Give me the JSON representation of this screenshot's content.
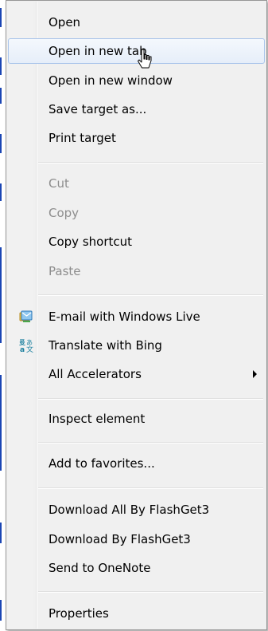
{
  "menu": {
    "items": [
      {
        "label": "Open",
        "state": "normal"
      },
      {
        "label": "Open in new tab",
        "state": "hover"
      },
      {
        "label": "Open in new window",
        "state": "normal"
      },
      {
        "label": "Save target as...",
        "state": "normal"
      },
      {
        "label": "Print target",
        "state": "normal"
      },
      {
        "label": "Cut",
        "state": "disabled"
      },
      {
        "label": "Copy",
        "state": "disabled"
      },
      {
        "label": "Copy shortcut",
        "state": "normal"
      },
      {
        "label": "Paste",
        "state": "disabled"
      },
      {
        "label": "E-mail with Windows Live",
        "state": "normal",
        "icon": "windows-live-mail-icon"
      },
      {
        "label": "Translate with Bing",
        "state": "normal",
        "icon": "bing-translate-icon"
      },
      {
        "label": "All Accelerators",
        "state": "normal",
        "submenu": true
      },
      {
        "label": "Inspect element",
        "state": "normal"
      },
      {
        "label": "Add to favorites...",
        "state": "normal"
      },
      {
        "label": "Download All By FlashGet3",
        "state": "normal"
      },
      {
        "label": "Download By FlashGet3",
        "state": "normal"
      },
      {
        "label": "Send to OneNote",
        "state": "normal"
      },
      {
        "label": "Properties",
        "state": "normal"
      }
    ]
  },
  "colors": {
    "menu_bg": "#f0f0f0",
    "hover_border": "#a9c4ea",
    "disabled_text": "#8d8d8d",
    "link_blue": "#1b46b4"
  }
}
